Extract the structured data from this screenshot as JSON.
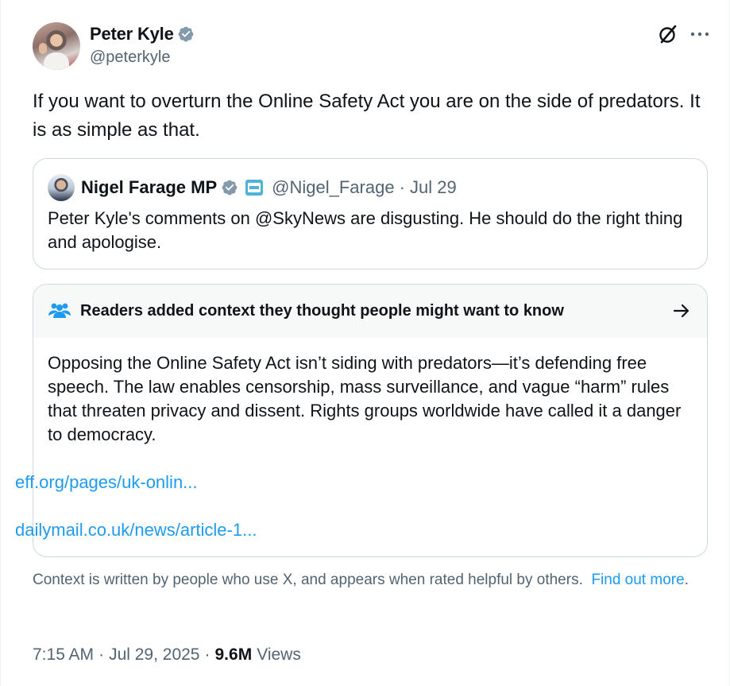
{
  "post": {
    "author": {
      "name": "Peter Kyle",
      "handle": "@peterkyle"
    },
    "text": "If you want to overturn the Online Safety Act you are on the side of predators. It is as simple as that.",
    "time": "7:15 AM",
    "date": "Jul 29, 2025",
    "views_count": "9.6M",
    "views_label": "Views",
    "sep": "·"
  },
  "quoted": {
    "name": "Nigel Farage MP",
    "handle": "@Nigel_Farage",
    "date": "· Jul 29",
    "text": "Peter Kyle's comments on @SkyNews are disgusting. He should do the right thing and apologise."
  },
  "community_note": {
    "title": "Readers added context they thought people might want to know",
    "body": "Opposing the Online Safety Act isn’t siding with predators—it’s defending free speech. The law enables censorship, mass surveillance, and vague “harm” rules that threaten privacy and dissent. Rights groups worldwide have called it a danger to democracy.",
    "links": [
      "eff.org/pages/uk-onlin...",
      "dailymail.co.uk/news/article-1..."
    ]
  },
  "disclaimer": {
    "text": "Context is written by people who use X, and appears when rated helpful by others.",
    "link": "Find out more",
    "end": "."
  },
  "icons": {
    "verified": "verified-badge-icon",
    "grok": "grok-icon",
    "more": "more-icon",
    "people": "people-icon",
    "arrow": "arrow-right-icon"
  },
  "colors": {
    "accent": "#1d9bf0",
    "text": "#0f1419",
    "muted": "#536471",
    "border": "#cfd9de",
    "note_header_bg": "#f7f9f9"
  }
}
